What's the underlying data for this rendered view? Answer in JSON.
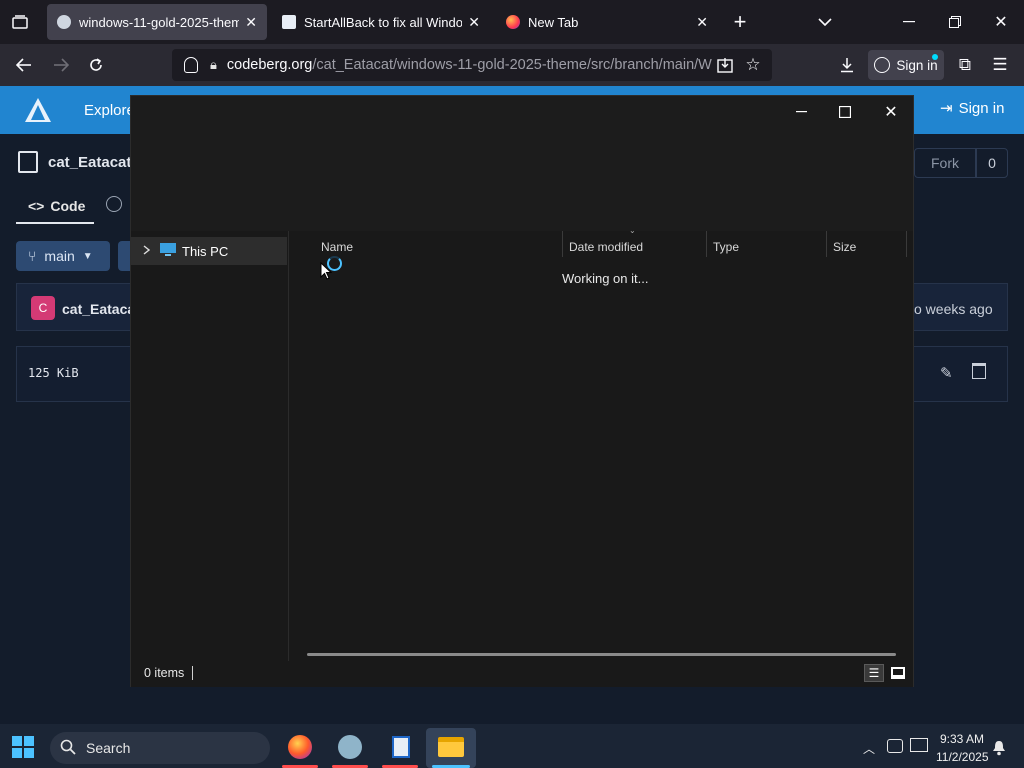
{
  "browser": {
    "tabs": [
      {
        "label": "windows-11-gold-2025-theme/",
        "active": true
      },
      {
        "label": "StartAllBack to fix all Windows",
        "active": false
      },
      {
        "label": "New Tab",
        "active": false
      }
    ],
    "url_host": "codeberg.org",
    "url_path": "/cat_Eatacat/windows-11-gold-2025-theme/src/branch/main/W",
    "sign_in": "Sign in"
  },
  "codeberg": {
    "explore": "Explore",
    "sign_in": "Sign in",
    "repo_owner": "cat_Eatacat",
    "tab_code": "Code",
    "branch": "main",
    "committer": "cat_Eatacat",
    "commit_time": "o weeks ago",
    "file_size": "125 KiB",
    "fork_label": "Fork",
    "fork_count": "0",
    "avatar_letter": "C"
  },
  "dialog": {
    "tree_item": "This PC",
    "columns": {
      "name": "Name",
      "date": "Date modified",
      "type": "Type",
      "size": "Size"
    },
    "status_message": "Working on it...",
    "item_count": "0 items"
  },
  "taskbar": {
    "search": "Search",
    "time": "9:33 AM",
    "date": "11/2/2025"
  },
  "colors": {
    "codeberg_blue": "#2185d0",
    "dialog_bg": "#191919",
    "taskbar_bg": "#1b2535"
  }
}
